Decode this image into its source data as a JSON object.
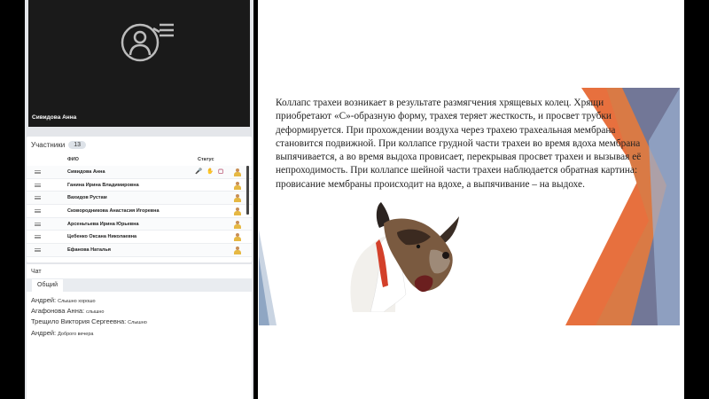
{
  "video": {
    "speaker_name": "Сивидова Анна",
    "icon": "camera-off-user-icon"
  },
  "participants": {
    "title": "Участники",
    "count": "13",
    "col_name": "ФИО",
    "col_status": "Статус",
    "rows": [
      {
        "name": "Сивидова Анна",
        "mic": true,
        "hand": true,
        "screen": true
      },
      {
        "name": "Ганина Ирина Владимировна",
        "mic": false,
        "hand": false,
        "screen": false
      },
      {
        "name": "Вахидов Рустам",
        "mic": false,
        "hand": false,
        "screen": false
      },
      {
        "name": "Сковородникова Анастасия Игоревна",
        "mic": false,
        "hand": false,
        "screen": false
      },
      {
        "name": "Арсеньтьева Ирина Юрьевна",
        "mic": false,
        "hand": false,
        "screen": false
      },
      {
        "name": "Цебенко Оксана Николаевна",
        "mic": false,
        "hand": false,
        "screen": false
      },
      {
        "name": "Ефанова Наталья",
        "mic": false,
        "hand": false,
        "screen": false
      }
    ]
  },
  "chat": {
    "title": "Чат",
    "tab": "Общий",
    "messages": [
      {
        "author": "Андрей:",
        "text": "Слышно хорошо"
      },
      {
        "author": "Агафонова  Анна:",
        "text": "слышно"
      },
      {
        "author": "Трещило Виктория Сергеевна:",
        "text": "Слышно"
      },
      {
        "author": "Андрей:",
        "text": "Доброго вечера"
      }
    ]
  },
  "slide": {
    "text": "Коллапс трахеи возникает в результате размягчения хрящевых колец. Хрящи приобретают «С»-образную форму, трахея теряет жесткость, и просвет трубки деформируется. При прохождении воздуха через трахею трахеальная мембрана становится подвижной. При коллапсе грудной части трахеи во время вдоха мембрана выпячивается, а во время выдоха провисает, перекрывая просвет трахеи и вызывая её непроходимость. При коллапсе шейной части трахеи наблюдается обратная картина: провисание мембраны происходит на вдохе, а выпячивание – на выдохе.",
    "image": "coughing-dog-illustration"
  }
}
